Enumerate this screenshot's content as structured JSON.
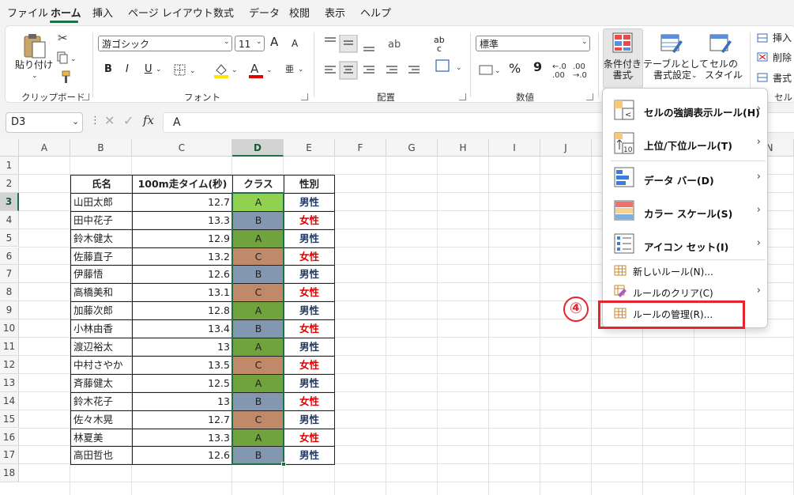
{
  "menu": {
    "tabs": [
      "ファイル",
      "ホーム",
      "挿入",
      "ページ レイアウト",
      "数式",
      "データ",
      "校閲",
      "表示",
      "ヘルプ"
    ],
    "active": "ホーム"
  },
  "ribbon": {
    "clipboard": {
      "paste_label": "貼り付け",
      "group_label": "クリップボード"
    },
    "font": {
      "font_name": "游ゴシック",
      "font_size": "11",
      "group_label": "フォント",
      "bold": "B",
      "italic": "I",
      "underline": "U",
      "grow": "A",
      "shrink": "A",
      "phonetic": "亜"
    },
    "alignment": {
      "group_label": "配置",
      "wrap": "ab\nc"
    },
    "number": {
      "format": "標準",
      "group_label": "数値",
      "percent": "%",
      "comma": "9"
    },
    "styles": {
      "conditional_formatting": "条件付き\n書式",
      "format_as_table": "テーブルとして\n書式設定",
      "cell_styles": "セルの\nスタイル"
    },
    "cells": {
      "insert": "挿入",
      "delete": "削除",
      "format": "書式",
      "group_label": "セル"
    }
  },
  "formula_bar": {
    "name_box": "D3",
    "fx": "fx",
    "value": "A"
  },
  "sheet": {
    "columns": [
      "A",
      "B",
      "C",
      "D",
      "E",
      "F",
      "G",
      "H",
      "I",
      "J",
      "K",
      "L",
      "M",
      "N"
    ],
    "rows": [
      "1",
      "2",
      "3",
      "4",
      "5",
      "6",
      "7",
      "8",
      "9",
      "10",
      "11",
      "12",
      "13",
      "14",
      "15",
      "16",
      "17",
      "18"
    ],
    "selected_column": "D",
    "selected_row": "3",
    "table": {
      "headers": [
        "氏名",
        "100m走タイム(秒)",
        "クラス",
        "性別"
      ],
      "rows": [
        [
          "山田太郎",
          "12.7",
          "A",
          "男性"
        ],
        [
          "田中花子",
          "13.3",
          "B",
          "女性"
        ],
        [
          "鈴木健太",
          "12.9",
          "A",
          "男性"
        ],
        [
          "佐藤直子",
          "13.2",
          "C",
          "女性"
        ],
        [
          "伊藤悟",
          "12.6",
          "B",
          "男性"
        ],
        [
          "高橋美和",
          "13.1",
          "C",
          "女性"
        ],
        [
          "加藤次郎",
          "12.8",
          "A",
          "男性"
        ],
        [
          "小林由香",
          "13.4",
          "B",
          "女性"
        ],
        [
          "渡辺裕太",
          "13",
          "A",
          "男性"
        ],
        [
          "中村さやか",
          "13.5",
          "C",
          "女性"
        ],
        [
          "斉藤健太",
          "12.5",
          "A",
          "男性"
        ],
        [
          "鈴木花子",
          "13",
          "B",
          "女性"
        ],
        [
          "佐々木晃",
          "12.7",
          "C",
          "男性"
        ],
        [
          "林夏美",
          "13.3",
          "A",
          "女性"
        ],
        [
          "高田哲也",
          "12.6",
          "B",
          "男性"
        ]
      ]
    },
    "colors": {
      "class_A": "#70a33e",
      "class_A_selected": "#92d050",
      "class_B": "#8497b0",
      "class_C": "#c0896a",
      "male": "#1f3864",
      "female": "#e00000"
    }
  },
  "cf_menu": {
    "items": [
      {
        "label": "セルの強調表示ルール(H)",
        "icon": "highlight-rules-icon",
        "submenu": true
      },
      {
        "label": "上位/下位ルール(T)",
        "icon": "top-bottom-icon",
        "submenu": true
      },
      {
        "label": "データ バー(D)",
        "icon": "data-bars-icon",
        "submenu": true
      },
      {
        "label": "カラー スケール(S)",
        "icon": "color-scales-icon",
        "submenu": true
      },
      {
        "label": "アイコン セット(I)",
        "icon": "icon-sets-icon",
        "submenu": true
      },
      {
        "label": "新しいルール(N)...",
        "icon": "new-rule-icon",
        "submenu": false
      },
      {
        "label": "ルールのクリア(C)",
        "icon": "clear-rules-icon",
        "submenu": true
      },
      {
        "label": "ルールの管理(R)...",
        "icon": "manage-rules-icon",
        "submenu": false
      }
    ]
  },
  "annotation": {
    "step": "④"
  }
}
